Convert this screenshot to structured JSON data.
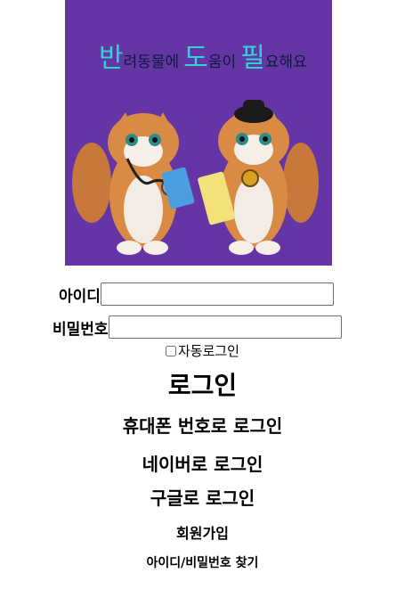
{
  "banner": {
    "title_part1": "반",
    "title_part2": "려동물에",
    "title_part3": "도",
    "title_part4": "움이",
    "title_part5": "필",
    "title_part6": "요해요",
    "bg_color": "#6535a6"
  },
  "form": {
    "id_label": "아이디",
    "pw_label": "비밀번호",
    "auto_login_label": "자동로그인"
  },
  "actions": {
    "login": "로그인",
    "phone_login": "휴대폰 번호로 로그인",
    "naver_login": "네이버로 로그인",
    "google_login": "구글로 로그인",
    "signup": "회원가입",
    "find_account": "아이디/비밀번호 찾기"
  }
}
